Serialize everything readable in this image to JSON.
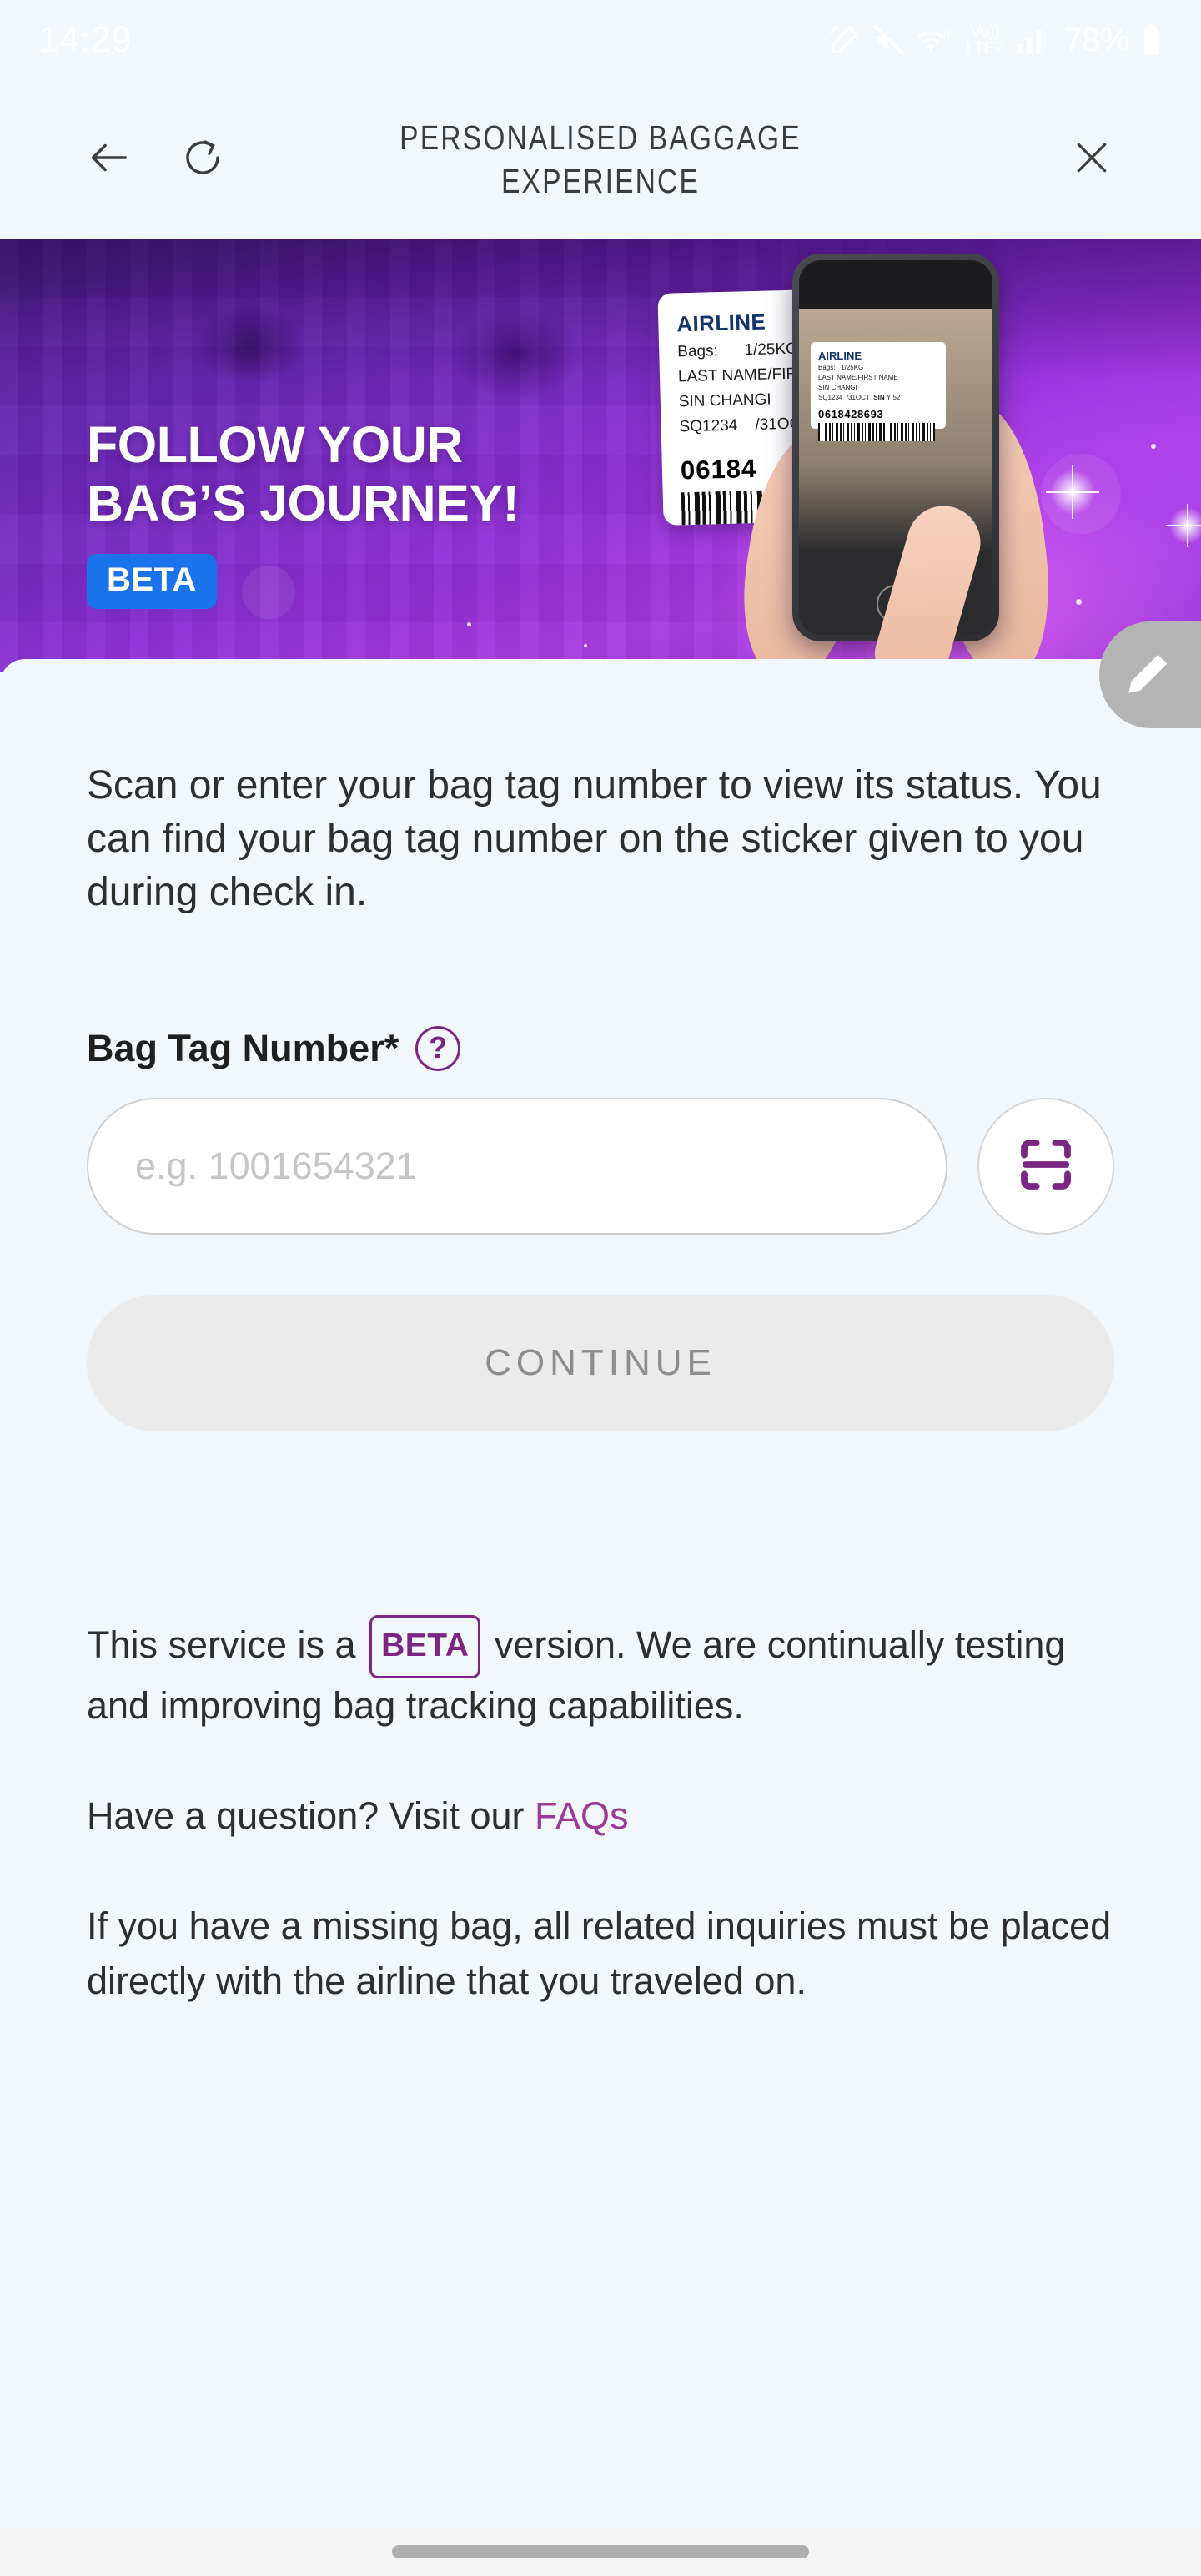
{
  "status_bar": {
    "time": "14:29",
    "battery_percent": "78%",
    "network_label": "LTE2",
    "volte_label": "Vo",
    "wifi_generation": "6",
    "icons": [
      "stylus-icon",
      "mute-icon",
      "wifi-icon",
      "volte-icon",
      "signal-icon",
      "battery-icon"
    ]
  },
  "header": {
    "title": "PERSONALISED BAGGAGE EXPERIENCE",
    "back_icon": "back-arrow-icon",
    "refresh_icon": "refresh-icon",
    "close_icon": "close-icon"
  },
  "hero": {
    "headline_line1": "FOLLOW YOUR",
    "headline_line2": "BAG’S JOURNEY!",
    "badge": "BETA",
    "badge_color": "#1b73eb",
    "bag_tag": {
      "airline": "AIRLINE",
      "bags_label": "Bags:",
      "bags_value": "1/25KG",
      "passenger": "LAST NAME/FIRST NAME",
      "destination": "SIN CHANGI",
      "flight": "SQ1234",
      "date": "/31OCT",
      "tag_number_partial": "06184"
    },
    "phone_tag": {
      "airline": "AIRLINE",
      "bags_label": "Bags:",
      "bags_value": "1/25KG",
      "passenger": "LAST NAME/FIRST NAME",
      "destination": "SIN CHANGI",
      "flight": "SQ1234",
      "date": "/31OCT",
      "seat_airport": "SIN",
      "seat_class": "Y",
      "seat_number": "52",
      "tag_number": "0618428693"
    }
  },
  "feedback": {
    "icon": "pencil-icon"
  },
  "main": {
    "intro": "Scan or enter your bag tag number to view its status. You can find your bag tag number on the sticker given to you during check in.",
    "field_label": "Bag Tag Number*",
    "help_icon_glyph": "?",
    "input_placeholder": "e.g. 1001654321",
    "input_value": "",
    "scan_icon": "barcode-scan-icon",
    "continue_label": "CONTINUE",
    "continue_disabled": true
  },
  "notes": {
    "beta_note_before": "This service is a",
    "beta_badge": "BETA",
    "beta_note_after": "version. We are continually testing and improving bag tracking capabilities.",
    "faq_text": "Have a question? Visit our",
    "faq_link": "FAQs",
    "missing_bag_note": "If you have a missing bag, all related inquiries must be placed directly with the airline that you traveled on."
  },
  "colors": {
    "accent_purple": "#7b2682",
    "link_purple": "#9c3a97",
    "badge_blue": "#1b73eb",
    "page_background": "#f1f7fa",
    "disabled_button": "#ebebeb"
  },
  "nav": {
    "home_indicator": "home-indicator"
  }
}
